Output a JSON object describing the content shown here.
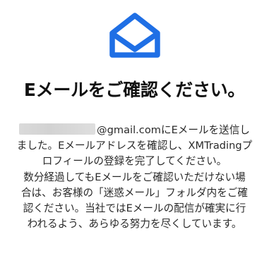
{
  "icon": {
    "name": "mail-open-icon",
    "color": "#1f6fe5"
  },
  "title": "Eメールをご確認ください。",
  "message": {
    "email_domain": "@gmail.com",
    "line1_suffix": "にEメールを送信し",
    "lines": [
      "ました。Eメールアドレスを確認し、XMTradingプ",
      "ロフィールの登録を完了してください。",
      "数分経過してもEメールをご確認いただけない場",
      "合は、お客様の「迷惑メール」フォルダ内をご確",
      "認ください。当社ではEメールの配信が確実に行",
      "われるよう、あらゆる努力を尽くしています。"
    ]
  }
}
